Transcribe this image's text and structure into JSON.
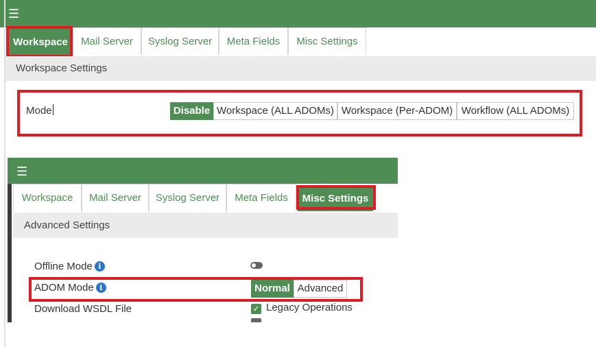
{
  "top_panel": {
    "menu_icon": "hamburger-menu-icon",
    "tabs": [
      {
        "label": "Workspace",
        "active": true
      },
      {
        "label": "Mail Server",
        "active": false
      },
      {
        "label": "Syslog Server",
        "active": false
      },
      {
        "label": "Meta Fields",
        "active": false
      },
      {
        "label": "Misc Settings",
        "active": false
      }
    ],
    "section_title": "Workspace Settings",
    "mode_label": "Mode",
    "mode_options": [
      {
        "label": "Disable",
        "selected": true
      },
      {
        "label": "Workspace (ALL ADOMs)",
        "selected": false
      },
      {
        "label": "Workspace (Per-ADOM)",
        "selected": false
      },
      {
        "label": "Workflow (ALL ADOMs)",
        "selected": false
      }
    ]
  },
  "bottom_panel": {
    "menu_icon": "hamburger-menu-icon",
    "tabs": [
      {
        "label": "Workspace",
        "active": false
      },
      {
        "label": "Mail Server",
        "active": false
      },
      {
        "label": "Syslog Server",
        "active": false
      },
      {
        "label": "Meta Fields",
        "active": false
      },
      {
        "label": "Misc Settings",
        "active": true
      }
    ],
    "section_title": "Advanced Settings",
    "offline_mode_label": "Offline Mode",
    "offline_mode_on": false,
    "adom_mode_label": "ADOM Mode",
    "adom_mode_options": [
      {
        "label": "Normal",
        "selected": true
      },
      {
        "label": "Advanced",
        "selected": false
      }
    ],
    "download_wsdl_label": "Download WSDL File",
    "legacy_operations_label": "Legacy Operations",
    "legacy_operations_checked": true
  },
  "colors": {
    "brand_green": "#4e8d53",
    "highlight_red": "#e01b24",
    "info_blue": "#2a74c9"
  }
}
